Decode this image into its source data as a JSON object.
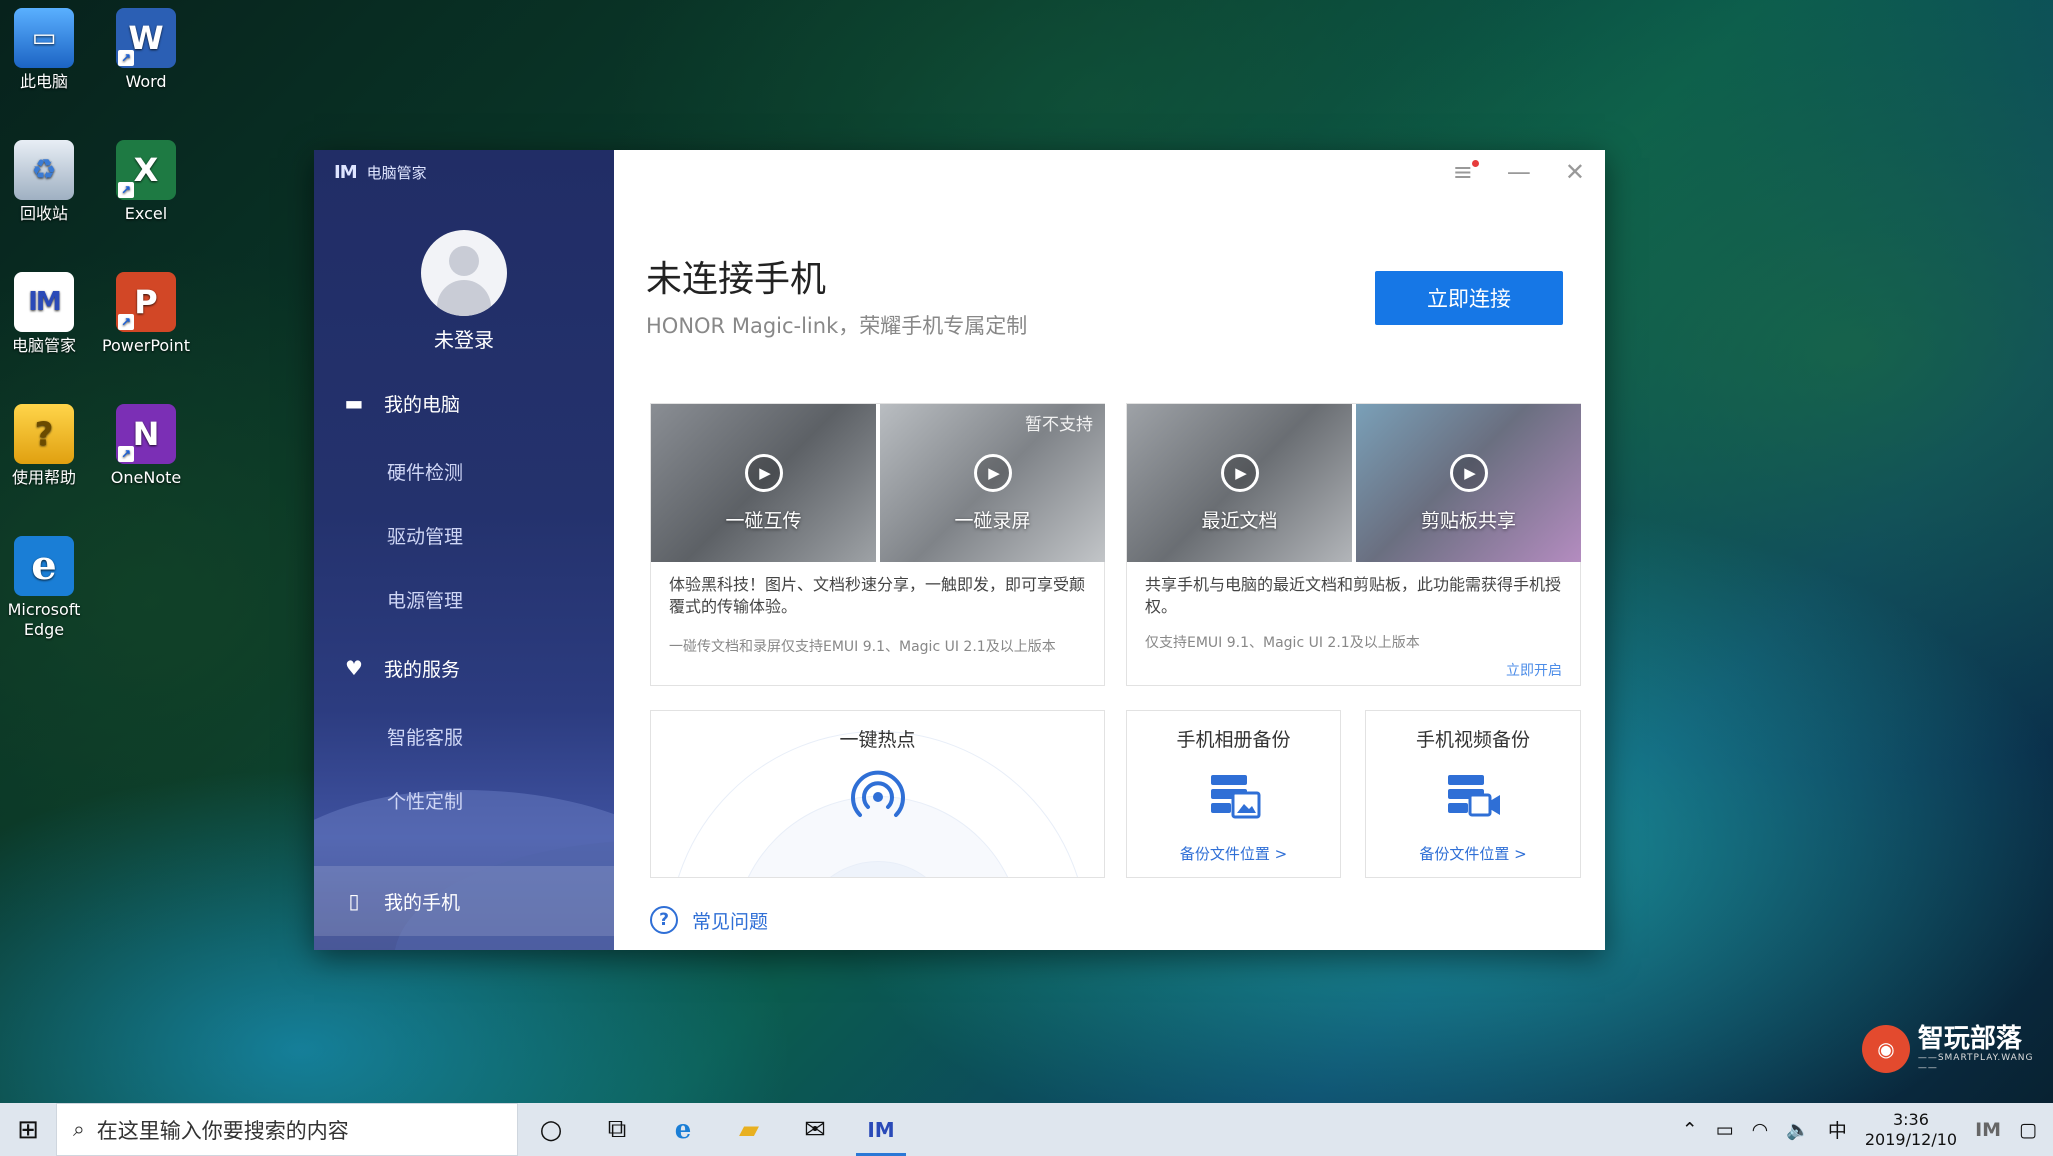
{
  "desktop": {
    "icons": [
      {
        "label": "此电脑",
        "glyph": "🖥"
      },
      {
        "label": "Word",
        "glyph": "W"
      },
      {
        "label": "回收站",
        "glyph": "🗑"
      },
      {
        "label": "Excel",
        "glyph": "X"
      },
      {
        "label": "电脑管家",
        "glyph": "IM"
      },
      {
        "label": "PowerPoint",
        "glyph": "P"
      },
      {
        "label": "使用帮助",
        "glyph": "?"
      },
      {
        "label": "OneNote",
        "glyph": "N"
      },
      {
        "label": "Microsoft Edge",
        "glyph": "e"
      }
    ]
  },
  "app": {
    "brand": "电脑管家",
    "brand_logo": "IM",
    "user": {
      "status": "未登录"
    },
    "nav": {
      "my_pc": "我的电脑",
      "hardware": "硬件检测",
      "drivers": "驱动管理",
      "power": "电源管理",
      "my_services": "我的服务",
      "smart_service": "智能客服",
      "personalize": "个性定制",
      "my_phone": "我的手机"
    },
    "header": {
      "title": "未连接手机",
      "subtitle": "HONOR Magic-link，荣耀手机专属定制",
      "connect_button": "立即连接"
    },
    "feature_cards": [
      {
        "thumbs": [
          {
            "label": "一碰互传",
            "badge": ""
          },
          {
            "label": "一碰录屏",
            "badge": "暂不支持"
          }
        ],
        "desc": "体验黑科技！图片、文档秒速分享，一触即发，即可享受颠覆式的传输体验。",
        "note": "一碰传文档和录屏仅支持EMUI 9.1、Magic UI 2.1及以上版本",
        "link": ""
      },
      {
        "thumbs": [
          {
            "label": "最近文档",
            "badge": ""
          },
          {
            "label": "剪贴板共享",
            "badge": ""
          }
        ],
        "desc": "共享手机与电脑的最近文档和剪贴板，此功能需获得手机授权。",
        "note": "仅支持EMUI 9.1、Magic UI 2.1及以上版本",
        "link": "立即开启"
      }
    ],
    "tools": {
      "hotspot": {
        "title": "一键热点"
      },
      "photo_backup": {
        "title": "手机相册备份",
        "link": "备份文件位置 >"
      },
      "video_backup": {
        "title": "手机视频备份",
        "link": "备份文件位置 >"
      }
    },
    "faq": "常见问题"
  },
  "taskbar": {
    "search_placeholder": "在这里输入你要搜索的内容",
    "tray_ime": "中",
    "time": "3:36",
    "date": "2019/12/10"
  },
  "watermark": {
    "title": "智玩部落",
    "sub": "——SMARTPLAY.WANG——"
  },
  "colors": {
    "accent": "#1677e6",
    "sidebar": "#24326d",
    "link": "#2f6fd6"
  }
}
